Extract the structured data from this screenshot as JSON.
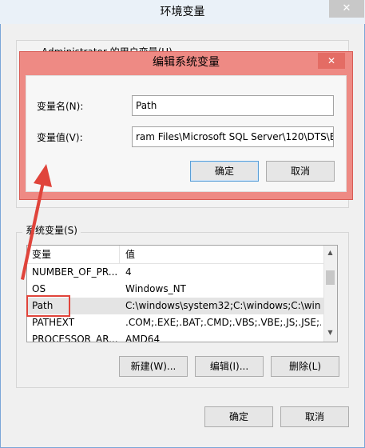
{
  "outer": {
    "title": "环境变量",
    "close_icon": "close-icon",
    "user_group_label": "Administrator 的用户变量(U)"
  },
  "dialog": {
    "title": "编辑系统变量",
    "close_icon": "close-icon",
    "name_label": "变量名(N):",
    "name_value": "Path",
    "value_label": "变量值(V):",
    "value_value": "ram Files\\Microsoft SQL Server\\120\\DTS\\B",
    "ok": "确定",
    "cancel": "取消"
  },
  "system": {
    "group_label": "系统变量(S)",
    "col_var": "变量",
    "col_val": "值",
    "rows": [
      {
        "name": "NUMBER_OF_PR...",
        "value": "4"
      },
      {
        "name": "OS",
        "value": "Windows_NT"
      },
      {
        "name": "Path",
        "value": "C:\\windows\\system32;C:\\windows;C:\\win..."
      },
      {
        "name": "PATHEXT",
        "value": ".COM;.EXE;.BAT;.CMD;.VBS;.VBE;.JS;.JSE;..."
      },
      {
        "name": "PROCESSOR_AR...",
        "value": "AMD64"
      }
    ],
    "new": "新建(W)...",
    "edit": "编辑(I)...",
    "delete": "删除(L)"
  },
  "footer": {
    "ok": "确定",
    "cancel": "取消"
  },
  "colors": {
    "highlight": "#e0443b",
    "dialog_frame": "#ee8a84"
  }
}
